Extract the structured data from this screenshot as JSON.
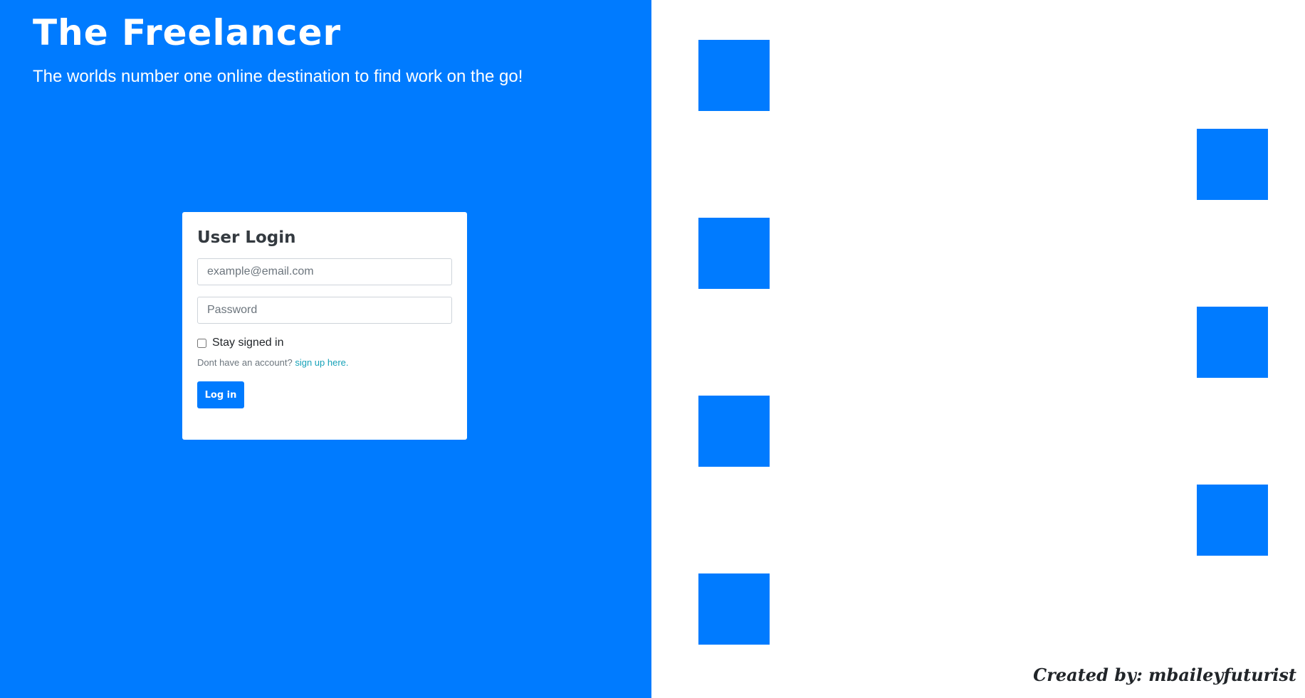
{
  "header": {
    "title": "The Freelancer",
    "tagline": "The worlds number one online destination to find work on the go!"
  },
  "login": {
    "title": "User Login",
    "email_placeholder": "example@email.com",
    "email_value": "",
    "password_placeholder": "Password",
    "password_value": "",
    "stay_signed_in_label": "Stay signed in",
    "stay_signed_in_checked": false,
    "signup_prompt": "Dont have an account?",
    "signup_link": "sign up here.",
    "button_label": "Log in"
  },
  "footer": {
    "credit": "Created by: mbaileyfuturist"
  },
  "colors": {
    "brand_blue": "#007bff",
    "link_teal": "#17a2b8",
    "background_white": "#ffffff"
  }
}
